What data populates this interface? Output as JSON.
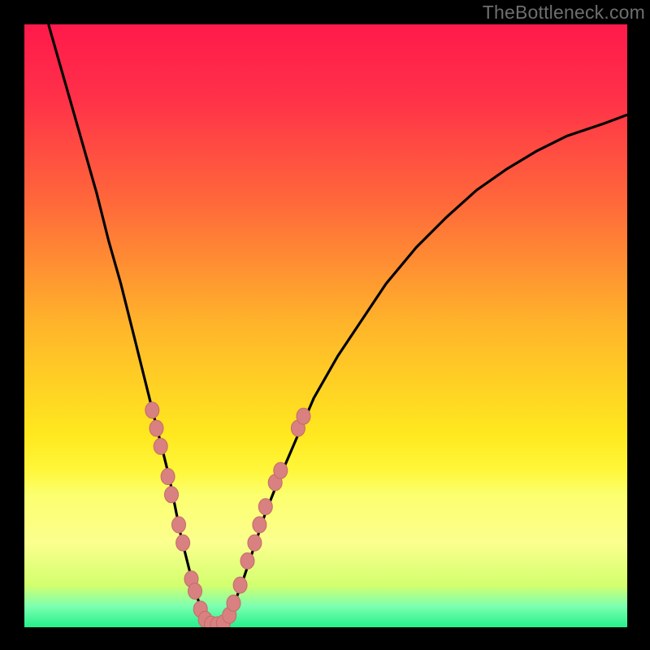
{
  "watermark": "TheBottleneck.com",
  "colors": {
    "gradient_stops": [
      {
        "offset": 0.0,
        "color": "#ff1a4b"
      },
      {
        "offset": 0.12,
        "color": "#ff3049"
      },
      {
        "offset": 0.3,
        "color": "#ff6a3a"
      },
      {
        "offset": 0.5,
        "color": "#ffb52a"
      },
      {
        "offset": 0.68,
        "color": "#ffe81f"
      },
      {
        "offset": 0.74,
        "color": "#fff73a"
      },
      {
        "offset": 0.78,
        "color": "#fcff6e"
      },
      {
        "offset": 0.86,
        "color": "#fbff8e"
      },
      {
        "offset": 0.93,
        "color": "#d3ff6e"
      },
      {
        "offset": 0.965,
        "color": "#7dffb1"
      },
      {
        "offset": 1.0,
        "color": "#24f08a"
      }
    ],
    "curve": "#000000",
    "marker_fill": "#d98080",
    "marker_stroke": "#c46a6a"
  },
  "chart_data": {
    "type": "line",
    "title": "",
    "xlabel": "",
    "ylabel": "",
    "xlim": [
      0,
      100
    ],
    "ylim": [
      0,
      100
    ],
    "grid": false,
    "legend": false,
    "series": [
      {
        "name": "bottleneck-curve",
        "x": [
          4,
          6,
          8,
          10,
          12,
          14,
          16,
          18,
          20,
          22,
          23,
          24,
          25,
          26,
          27,
          28,
          29,
          30,
          31,
          32,
          33,
          34,
          36,
          38,
          40,
          42,
          45,
          48,
          52,
          56,
          60,
          65,
          70,
          75,
          80,
          85,
          90,
          96,
          100
        ],
        "y": [
          100,
          93,
          86,
          79,
          72,
          64,
          57,
          49,
          41,
          33,
          29,
          25,
          20,
          15,
          11,
          7,
          4,
          1.5,
          0.5,
          0.3,
          0.7,
          2,
          7,
          13,
          19,
          24,
          31,
          38,
          45,
          51,
          57,
          63,
          68,
          72.5,
          76,
          79,
          81.5,
          83.5,
          85
        ]
      }
    ],
    "markers": [
      {
        "x": 21.2,
        "y": 36
      },
      {
        "x": 21.9,
        "y": 33
      },
      {
        "x": 22.6,
        "y": 30
      },
      {
        "x": 23.8,
        "y": 25
      },
      {
        "x": 24.4,
        "y": 22
      },
      {
        "x": 25.6,
        "y": 17
      },
      {
        "x": 26.3,
        "y": 14
      },
      {
        "x": 27.7,
        "y": 8
      },
      {
        "x": 28.3,
        "y": 6
      },
      {
        "x": 29.2,
        "y": 3
      },
      {
        "x": 30.0,
        "y": 1.3
      },
      {
        "x": 31.0,
        "y": 0.5
      },
      {
        "x": 32.0,
        "y": 0.4
      },
      {
        "x": 33.0,
        "y": 0.7
      },
      {
        "x": 34.0,
        "y": 2
      },
      {
        "x": 34.7,
        "y": 4
      },
      {
        "x": 35.8,
        "y": 7
      },
      {
        "x": 37.0,
        "y": 11
      },
      {
        "x": 38.2,
        "y": 14
      },
      {
        "x": 39.0,
        "y": 17
      },
      {
        "x": 40.0,
        "y": 20
      },
      {
        "x": 41.6,
        "y": 24
      },
      {
        "x": 42.5,
        "y": 26
      },
      {
        "x": 45.4,
        "y": 33
      },
      {
        "x": 46.3,
        "y": 35
      }
    ]
  }
}
